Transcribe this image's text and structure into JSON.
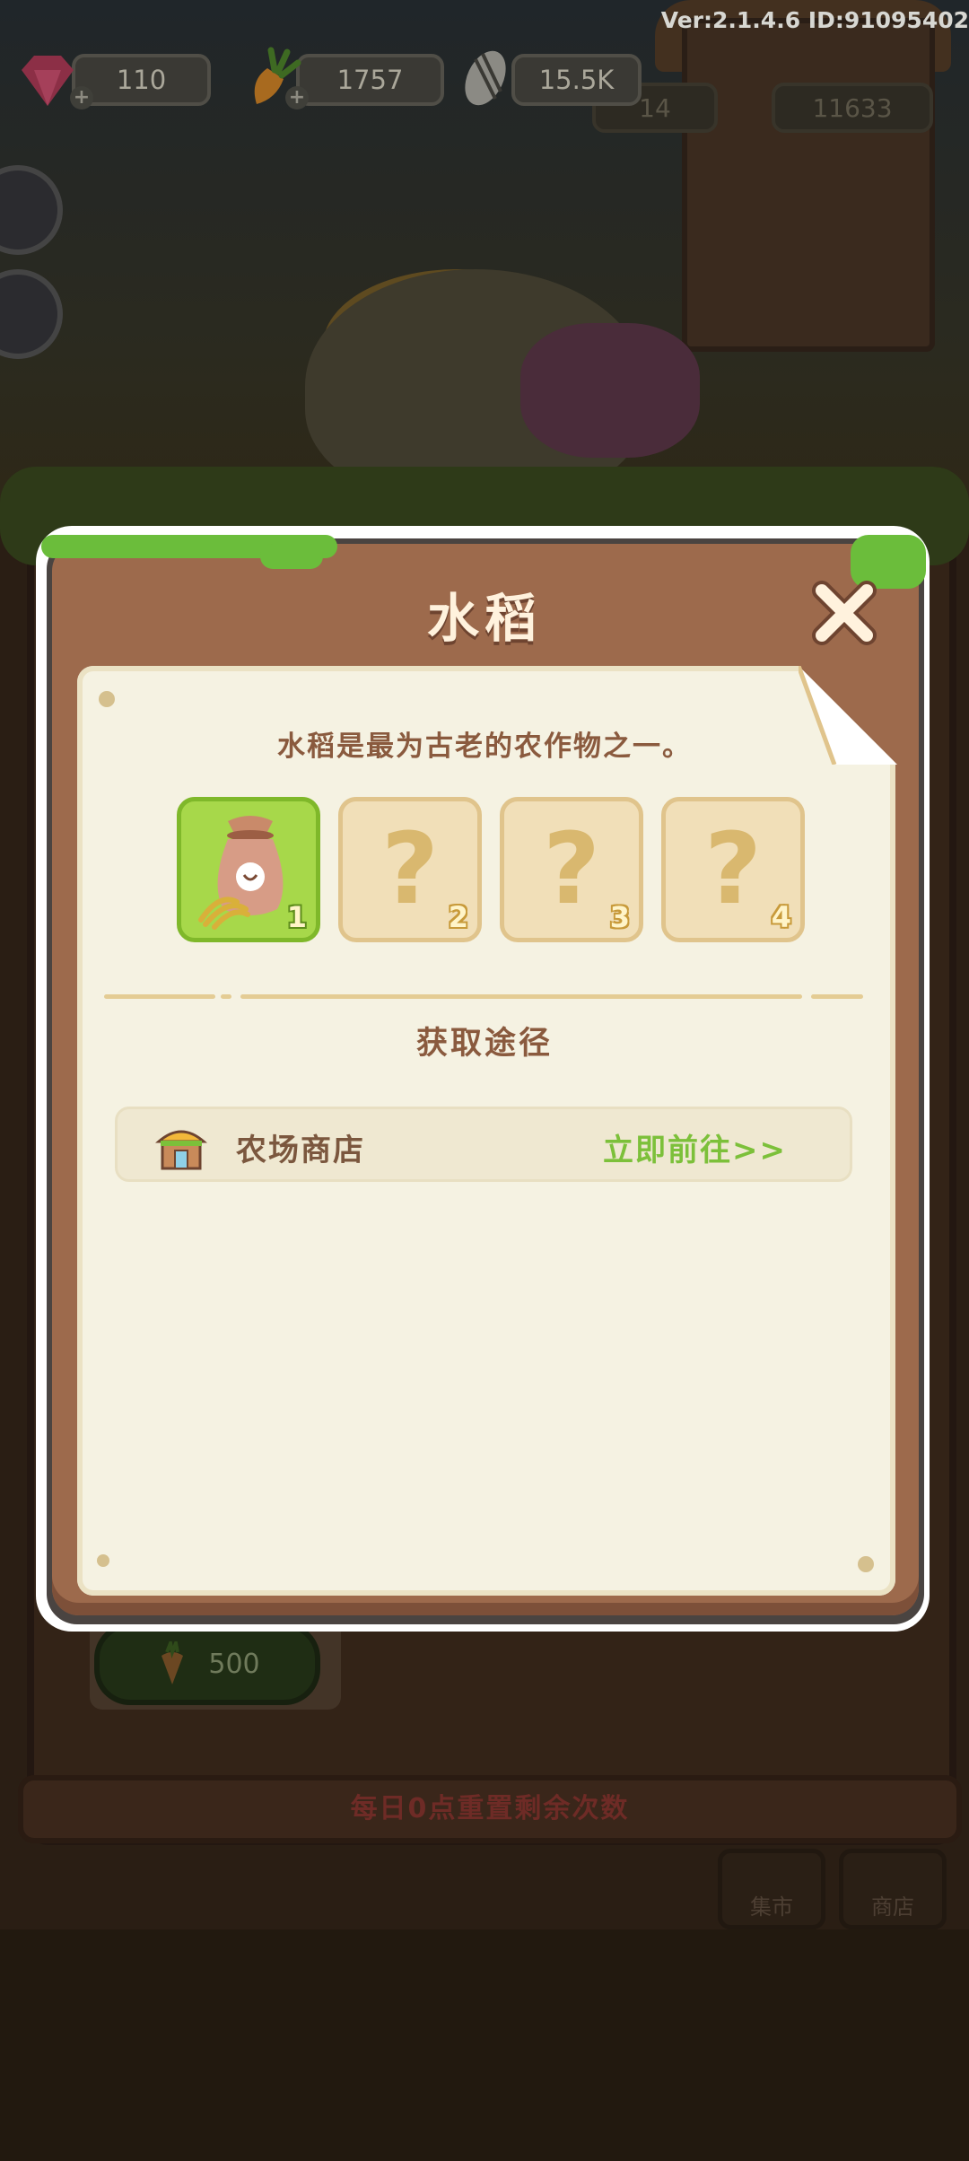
{
  "version_text": "Ver:2.1.4.6 ID:91095402",
  "currencies": {
    "gems": "110",
    "carrots": "1757",
    "seeds": "15.5K"
  },
  "background": {
    "coin_value": "11633",
    "extra_value": "14",
    "cost_value": "500",
    "reset_notice": "每日0点重置剩余次数",
    "tile_market": "集市",
    "tile_shop": "商店"
  },
  "dialog": {
    "title": "水稻",
    "description": "水稻是最为古老的农作物之一。",
    "stages": [
      {
        "label": "1",
        "unlocked": true
      },
      {
        "label": "2",
        "unlocked": false
      },
      {
        "label": "3",
        "unlocked": false
      },
      {
        "label": "4",
        "unlocked": false
      }
    ],
    "locked_symbol": "?",
    "section_title": "获取途径",
    "source": {
      "name": "农场商店",
      "action": "立即前往>>"
    }
  },
  "colors": {
    "wood": "#9d6a4c",
    "paper": "#f5f2e2",
    "accent_green": "#7cc03a",
    "text_brown": "#8a5a3e"
  }
}
